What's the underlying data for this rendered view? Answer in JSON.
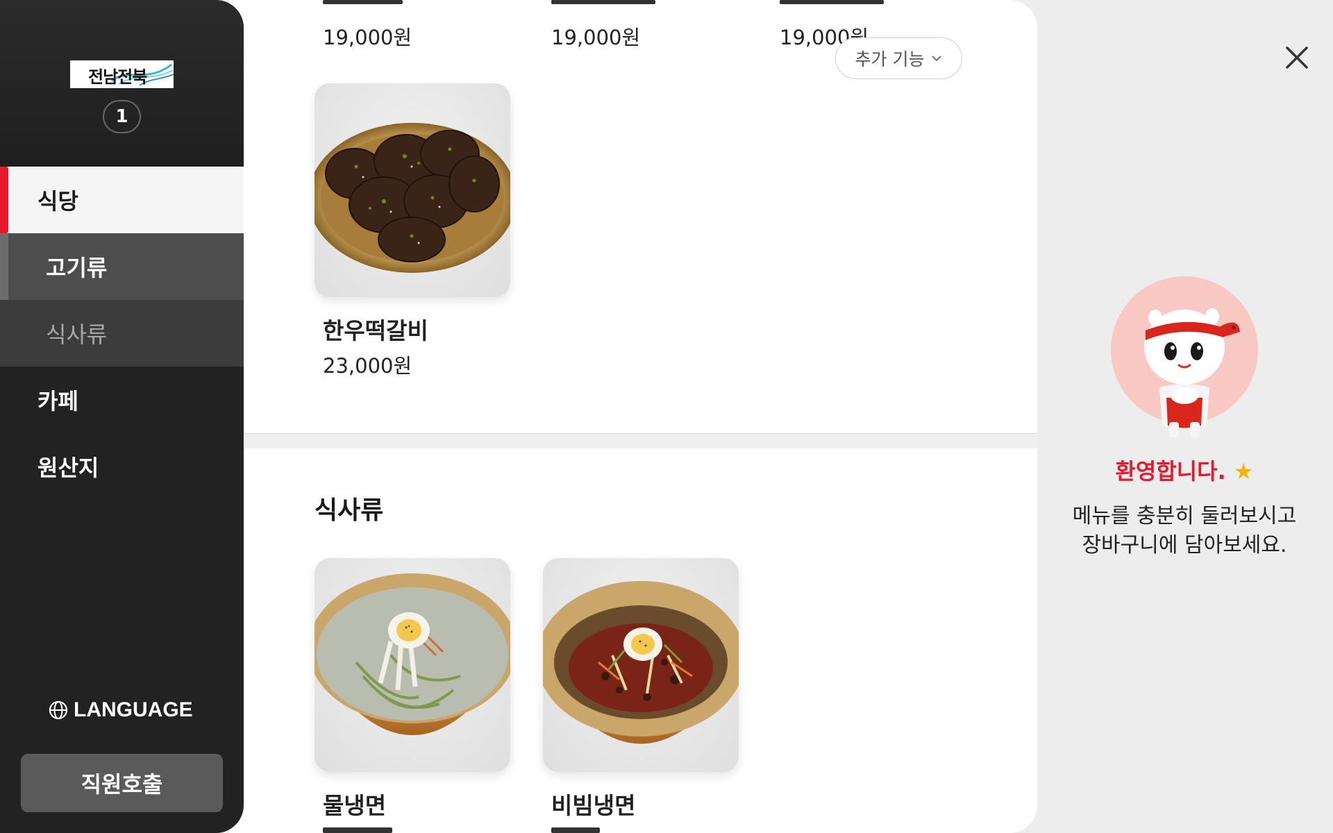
{
  "sidebar": {
    "logo_text": "전남전북",
    "table_number": "1",
    "nav": {
      "restaurant": "식당",
      "meat": "고기류",
      "meal": "식사류",
      "cafe": "카페",
      "origin": "원산지"
    },
    "language_label": "LANGUAGE",
    "call_staff_label": "직원호출"
  },
  "main": {
    "top_row_prices": [
      "19,000원",
      "19,000원",
      "19,000원"
    ],
    "more_features_label": "추가 기능",
    "meat_items": [
      {
        "name": "한우떡갈비",
        "price": "23,000원"
      }
    ],
    "meal_section_title": "식사류",
    "meal_items": [
      {
        "name": "물냉면"
      },
      {
        "name": "비빔냉면"
      }
    ]
  },
  "welcome_panel": {
    "title": "환영합니다.",
    "star": "★",
    "message_line1": "메뉴를 충분히 둘러보시고",
    "message_line2": "장바구니에 담아보세요."
  },
  "colors": {
    "accent_red": "#e8192c",
    "sidebar_bg": "#222222",
    "sub_active_bg": "#4d4d4d",
    "sub_inactive_bg": "#3c3c3c",
    "panel_bg": "#ededed"
  }
}
